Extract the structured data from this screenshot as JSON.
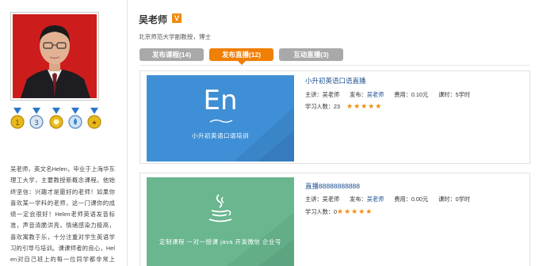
{
  "teacher": {
    "name": "吴老师",
    "badge": "V",
    "subtitle": "北京师范大学副教授，博士",
    "bio": "吴老师，英文名Helen，毕业于上海华东理工大学，主要教授新概念课程。他始终坚信：兴趣才是最好的老师！如果你喜欢某一学科的老师，这一门课你的成绩一定会很好！Helen老师英语发音标准，声音清脆洪亮，情绪感染力极高，喜欢寓教于乐，十分注重对学生英语学习的引导与培训。课课师者的良心，Helen对自己班上的每一位同学都非常上心，认真负责，宁愿学生说她严"
  },
  "tabs": [
    {
      "label": "发布课程(14)"
    },
    {
      "label": "发布直播(12)"
    },
    {
      "label": "互动直播(3)"
    }
  ],
  "courses": [
    {
      "title": "小升初英语口语直播",
      "thumb_text": "小升初英语口语培训",
      "thumb_big": "En",
      "lecturer_label": "主讲：",
      "lecturer": "吴老师",
      "publisher_label": "发布：",
      "publisher": "吴老师",
      "fee_label": "费用：",
      "fee": "0.10元",
      "hours_label": "课时：",
      "hours": "5学时",
      "learners_label": "学习人数：",
      "learners": "23",
      "stars": "★★★★★",
      "thumb_color": "#3f8fd6"
    },
    {
      "title": "直播88888888888",
      "thumb_text": "定制课程 一对一授课 java 开发微信 企业号",
      "lecturer_label": "主讲：",
      "lecturer": "吴老师",
      "publisher_label": "发布：",
      "publisher": "吴老师",
      "fee_label": "费用：",
      "fee": "0.00元",
      "hours_label": "课时：",
      "hours": "0学时",
      "learners_label": "学习人数：",
      "learners": "0",
      "stars": "★★★★★",
      "thumb_color": "#69b68f"
    }
  ]
}
